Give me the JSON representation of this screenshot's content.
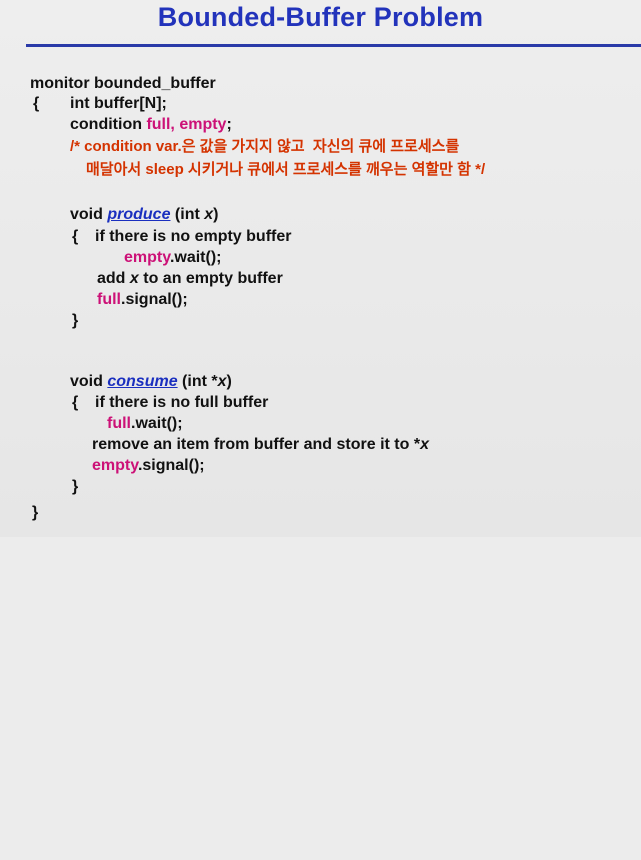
{
  "title": "Bounded-Buffer Problem",
  "code": {
    "monitor_decl": "monitor bounded_buffer",
    "open_brace": "{",
    "buffer_decl": "int buffer[N];",
    "condition_kw": "condition ",
    "condition_vars": "full, empty",
    "condition_semicolon": ";",
    "comment_line1_pre": "/* condition var.",
    "comment_line1_kr": "은 값을 가지지 않고  자신의 큐에 프로세스를",
    "comment_line2_kr1": "매달아서 ",
    "comment_line2_sleep": "sleep ",
    "comment_line2_kr2": "시키거나 큐에서 프로세스를 깨우는 역할만 함 */",
    "produce": {
      "sig_pre": "void ",
      "name": "produce",
      "sig_args_pre": " (int ",
      "sig_arg": "x",
      "sig_close": ")",
      "brace_open": "{",
      "if_line": "if there is no empty buffer",
      "wait_var": "empty",
      "wait_call": ".wait();",
      "add_pre": "add ",
      "add_var": "x",
      "add_post": " to an empty buffer",
      "signal_var": "full",
      "signal_call": ".signal();",
      "brace_close": "}"
    },
    "consume": {
      "sig_pre": "void ",
      "name": "consume",
      "sig_args_pre": " (int *",
      "sig_arg": "x",
      "sig_close": ")",
      "brace_open": "{",
      "if_line": "if there is no full buffer",
      "wait_var": "full",
      "wait_call": ".wait();",
      "remove_pre": "remove an item from buffer and store it to *",
      "remove_var": "x",
      "signal_var": "empty",
      "signal_call": ".signal();",
      "brace_close": "}"
    },
    "close_brace": "}"
  },
  "colors": {
    "title": "#2233bb",
    "rule": "#2a3aa8",
    "condition_vars": "#cc1177",
    "comment": "#d43300",
    "function_name": "#1a2fbf"
  }
}
